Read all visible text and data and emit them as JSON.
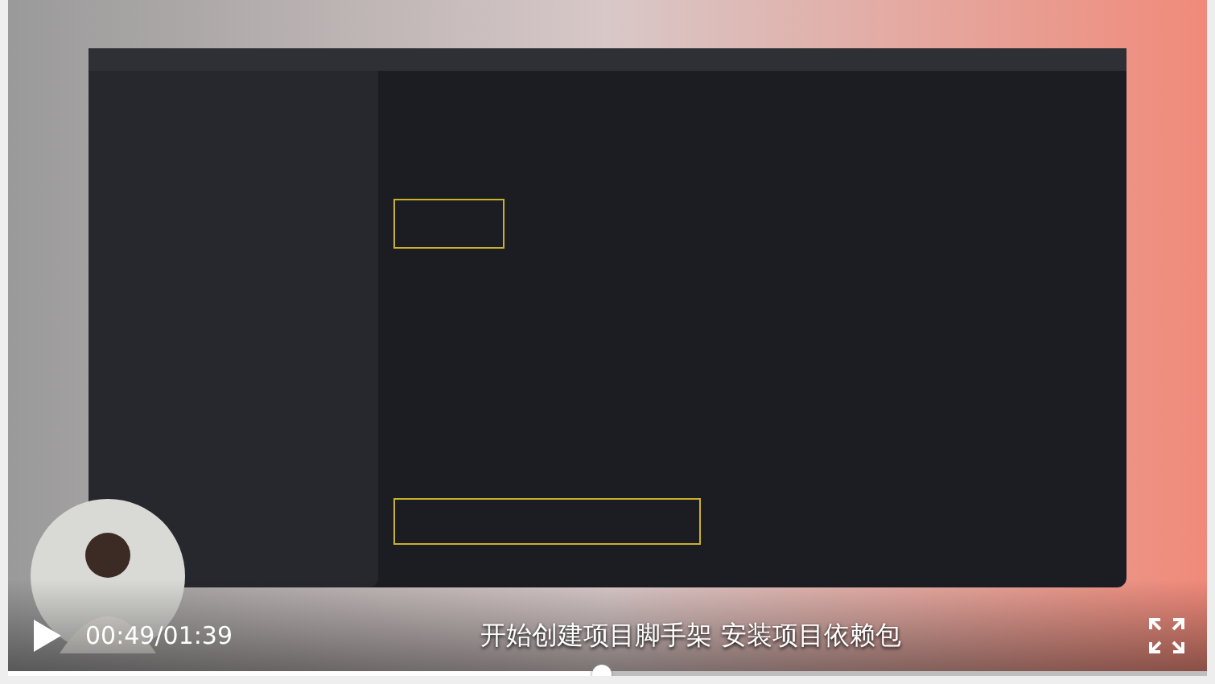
{
  "controls": {
    "playing": false,
    "time": "00:49/01:39",
    "subtitle": "开始创建项目脚手架 安装项目依赖包",
    "progress": {
      "level": 0.495
    }
  }
}
